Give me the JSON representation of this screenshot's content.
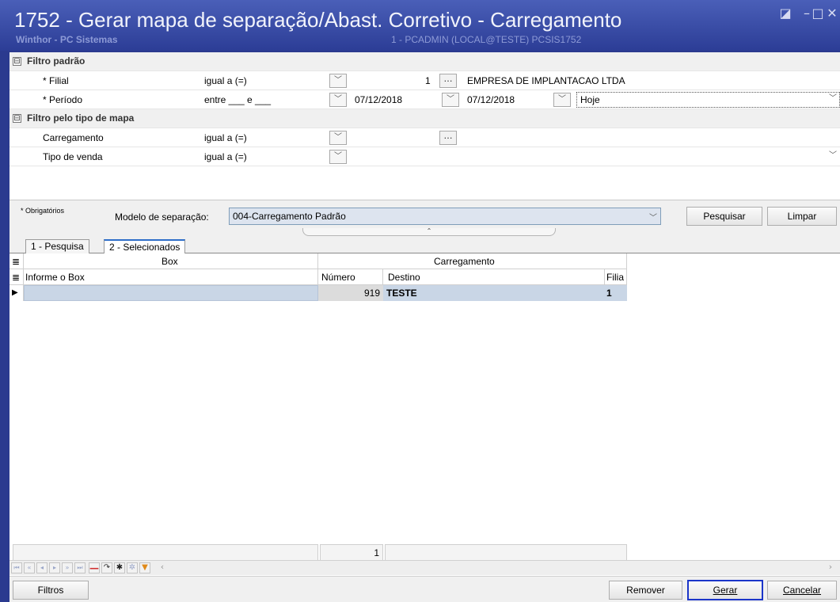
{
  "window": {
    "title": "1752 - Gerar mapa de separação/Abast. Corretivo - Carregamento",
    "app_name": "Winthor - PC Sistemas",
    "session_info": "1 - PCADMIN (LOCAL@TESTE)  PCSIS1752",
    "title_color": "#2c3d96"
  },
  "filters": {
    "group1": {
      "expander": "⊟",
      "label": "Filtro padrão"
    },
    "filial": {
      "label": "* Filial",
      "operator": "igual a (=)",
      "code": "1",
      "description": "EMPRESA DE IMPLANTACAO LTDA"
    },
    "periodo": {
      "label": "* Período",
      "operator": "entre ___ e ___",
      "date_start": "07/12/2018",
      "date_end": "07/12/2018",
      "preset": "Hoje"
    },
    "group2": {
      "expander": "⊟",
      "label": "Filtro pelo tipo de mapa"
    },
    "carregamento": {
      "label": "Carregamento",
      "operator": "igual a (=)",
      "value": ""
    },
    "tipo_venda": {
      "label": "Tipo de venda",
      "operator": "igual a (=)",
      "value": ""
    }
  },
  "middle": {
    "required_note": "* Obrigatórios",
    "modelo_label": "Modelo de separação:",
    "modelo_value": "004-Carregamento Padrão",
    "pesquisar_label": "Pesquisar",
    "limpar_label": "Limpar",
    "splitter_symbol": "⌃"
  },
  "tabs": [
    {
      "label": "1 - Pesquisa",
      "active": false
    },
    {
      "label": "2 - Selecionados",
      "active": true
    }
  ],
  "grid": {
    "band_box": "Box",
    "band_carregamento": "Carregamento",
    "columns": {
      "box": "Informe o Box",
      "numero": "Número",
      "destino": "Destino",
      "filial": "Filia"
    },
    "rows": [
      {
        "box": "",
        "numero": "919",
        "destino": "TESTE",
        "filial": "1"
      }
    ],
    "footer_count": "1",
    "row_indicator": "▶"
  },
  "bottom": {
    "filtros_label": "Filtros",
    "remover_label": "Remover",
    "gerar_label": "Gerar",
    "cancelar_label": "Cancelar",
    "focus_color": "#1b35c9"
  },
  "icons": {
    "dropdown": "chevron-down-icon",
    "ellipsis": "ellipsis-icon",
    "nav": [
      "first-icon",
      "prev-page-icon",
      "prev-icon",
      "next-icon",
      "next-page-icon",
      "last-icon",
      "delete-icon",
      "refresh-icon",
      "new-icon",
      "clear-icon",
      "filter-icon"
    ]
  }
}
